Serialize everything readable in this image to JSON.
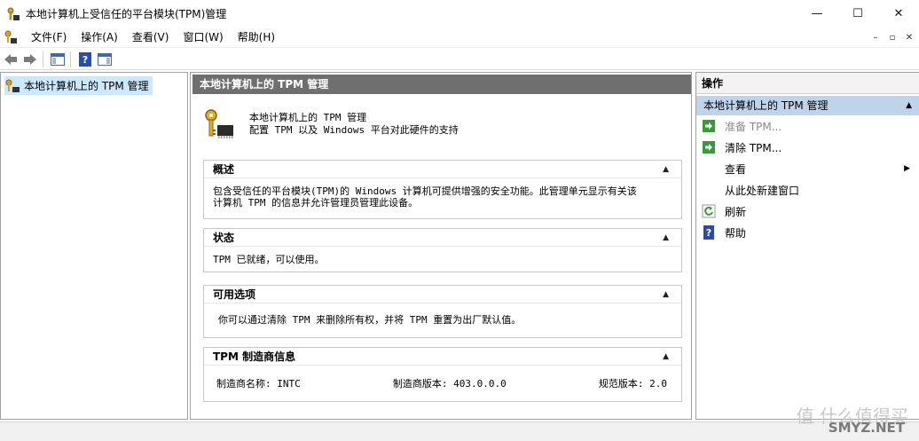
{
  "window": {
    "title": "本地计算机上受信任的平台模块(TPM)管理",
    "minimize": "—",
    "maximize": "☐",
    "close": "✕"
  },
  "menubar": {
    "items": [
      "文件(F)",
      "操作(A)",
      "查看(V)",
      "窗口(W)",
      "帮助(H)"
    ],
    "mdi_minimize": "–",
    "mdi_restore": "▫",
    "mdi_close": "✕"
  },
  "tree": {
    "root_label": "本地计算机上的 TPM 管理"
  },
  "center": {
    "header": "本地计算机上的 TPM 管理",
    "summary_title": "本地计算机上的 TPM 管理",
    "summary_desc": "配置 TPM 以及 Windows 平台对此硬件的支持",
    "overview": {
      "title": "概述",
      "line1": "包含受信任的平台模块(TPM)的 Windows 计算机可提供增强的安全功能。此管理单元显示有关该",
      "line2": "计算机 TPM 的信息并允许管理员管理此设备。"
    },
    "status": {
      "title": "状态",
      "text": "TPM 已就绪，可以使用。"
    },
    "options": {
      "title": "可用选项",
      "text": "你可以通过清除 TPM 来删除所有权，并将 TPM 重置为出厂默认值。"
    },
    "manufacturer": {
      "title": "TPM 制造商信息",
      "name": "制造商名称: INTC",
      "version": "制造商版本: 403.0.0.0",
      "spec": "规范版本: 2.0"
    },
    "collapse_glyph": "▲"
  },
  "actions": {
    "title": "操作",
    "group": "本地计算机上的 TPM 管理",
    "items": {
      "prepare": "准备 TPM...",
      "clear": "清除 TPM...",
      "view": "查看",
      "new_window": "从此处新建窗口",
      "refresh": "刷新",
      "help": "帮助"
    },
    "submenu_glyph": "▶"
  },
  "watermark": {
    "text1": "值 什么值得买",
    "text2": "SMYZ.NET"
  },
  "colors": {
    "header_bg": "#6f6f6f",
    "group_bg": "#bfd3ea",
    "tree_selected": "#cce8ff",
    "action_green": "#3a9a3a",
    "help_blue": "#2a4ca8"
  }
}
